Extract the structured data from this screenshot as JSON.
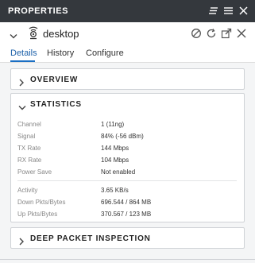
{
  "header": {
    "title": "PROPERTIES",
    "icons": [
      "bookmark-list-icon",
      "menu-icon",
      "close-icon"
    ]
  },
  "device": {
    "name": "desktop",
    "icon": "wireless-client-icon",
    "actions": [
      "block-icon",
      "refresh-icon",
      "expand-icon",
      "disconnect-icon"
    ]
  },
  "tabs": [
    {
      "label": "Details",
      "active": true
    },
    {
      "label": "History",
      "active": false
    },
    {
      "label": "Configure",
      "active": false
    }
  ],
  "sections": {
    "overview": {
      "title": "OVERVIEW",
      "expanded": false
    },
    "statistics": {
      "title": "STATISTICS",
      "expanded": true,
      "rows": [
        {
          "label": "Channel",
          "value": "1 (11ng)"
        },
        {
          "label": "Signal",
          "value": "84% (-56 dBm)"
        },
        {
          "label": "TX Rate",
          "value": "144 Mbps"
        },
        {
          "label": "RX Rate",
          "value": "104 Mbps"
        },
        {
          "label": "Power Save",
          "value": "Not enabled"
        }
      ],
      "rows2": [
        {
          "label": "Activity",
          "value": "3.65 KB/s"
        },
        {
          "label": "Down Pkts/Bytes",
          "value": "696.544 / 864 MB"
        },
        {
          "label": "Up Pkts/Bytes",
          "value": "370.567 / 123 MB"
        }
      ]
    },
    "dpi": {
      "title": "DEEP PACKET INSPECTION",
      "expanded": false
    }
  },
  "colors": {
    "header_bg": "#34383d",
    "accent": "#1a6fc4"
  }
}
